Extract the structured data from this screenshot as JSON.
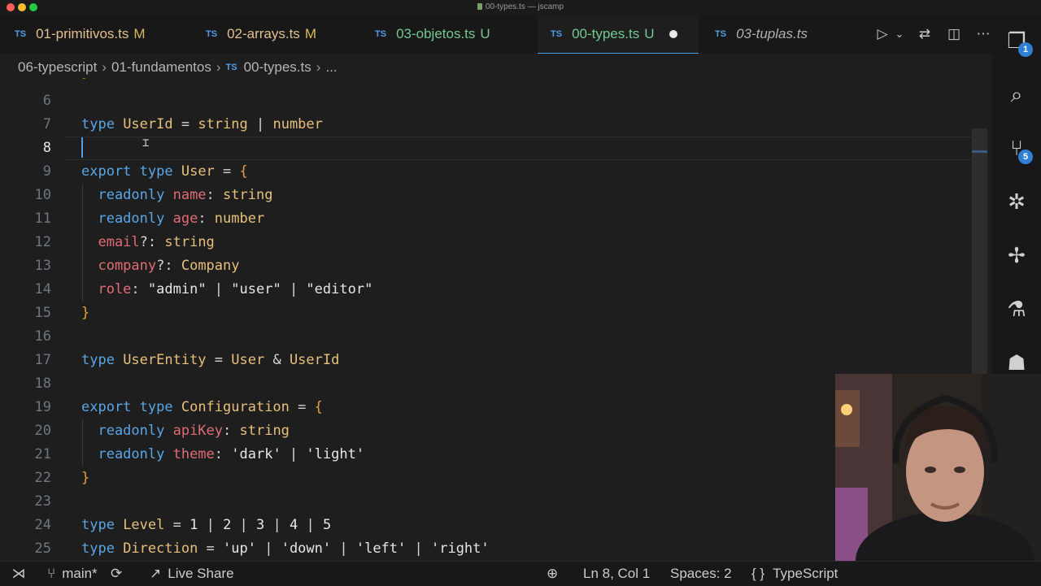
{
  "window": {
    "title": "00-types.ts — jscamp",
    "colors": {
      "close": "#ff5f57",
      "minimize": "#febc2e",
      "zoom": "#28c840"
    }
  },
  "tabs": [
    {
      "lang": "TS",
      "label": "01-primitivos.ts",
      "status": "M",
      "status_color": "#d9b65c",
      "label_color": "#e2c08d"
    },
    {
      "lang": "TS",
      "label": "02-arrays.ts",
      "status": "M",
      "status_color": "#d9b65c",
      "label_color": "#e2c08d"
    },
    {
      "lang": "TS",
      "label": "03-objetos.ts",
      "status": "U",
      "status_color": "#73c991",
      "label_color": "#73c991"
    },
    {
      "lang": "TS",
      "label": "00-types.ts",
      "status": "U",
      "status_color": "#73c991",
      "label_color": "#73c991",
      "active": true,
      "unsaved": true
    },
    {
      "lang": "TS",
      "label": "03-tuplas.ts",
      "status": "",
      "status_color": "#b0b0b0",
      "label_color": "#b0b0b0",
      "italic": true
    }
  ],
  "tab_actions": {
    "run": "▷",
    "run_dropdown": "⌄",
    "compare": "⇄",
    "split": "◫",
    "more": "⋯"
  },
  "breadcrumb": {
    "items": [
      "06-typescript",
      "01-fundamentos"
    ],
    "file_lang": "TS",
    "file": "00-types.ts",
    "trailing": "..."
  },
  "editor": {
    "first_line_partial": "}",
    "lines": [
      {
        "n": "6",
        "tokens": []
      },
      {
        "n": "7",
        "tokens": [
          {
            "t": "type ",
            "c": "kw"
          },
          {
            "t": "UserId",
            "c": "ty"
          },
          {
            "t": " = ",
            "c": "punc"
          },
          {
            "t": "string",
            "c": "ty"
          },
          {
            "t": " | ",
            "c": "punc"
          },
          {
            "t": "number",
            "c": "ty"
          }
        ]
      },
      {
        "n": "8",
        "current": true,
        "tokens": []
      },
      {
        "n": "9",
        "tokens": [
          {
            "t": "export ",
            "c": "kw"
          },
          {
            "t": "type ",
            "c": "kw"
          },
          {
            "t": "User",
            "c": "ty"
          },
          {
            "t": " = ",
            "c": "punc"
          },
          {
            "t": "{",
            "c": "brace"
          }
        ]
      },
      {
        "n": "10",
        "tokens": [
          {
            "t": "  readonly ",
            "c": "kw"
          },
          {
            "t": "name",
            "c": "prop"
          },
          {
            "t": ": ",
            "c": "punc"
          },
          {
            "t": "string",
            "c": "ty"
          }
        ]
      },
      {
        "n": "11",
        "tokens": [
          {
            "t": "  readonly ",
            "c": "kw"
          },
          {
            "t": "age",
            "c": "prop"
          },
          {
            "t": ": ",
            "c": "punc"
          },
          {
            "t": "number",
            "c": "ty"
          }
        ]
      },
      {
        "n": "12",
        "tokens": [
          {
            "t": "  email",
            "c": "prop"
          },
          {
            "t": "?: ",
            "c": "punc"
          },
          {
            "t": "string",
            "c": "ty"
          }
        ]
      },
      {
        "n": "13",
        "tokens": [
          {
            "t": "  company",
            "c": "prop"
          },
          {
            "t": "?: ",
            "c": "punc"
          },
          {
            "t": "Company",
            "c": "ty"
          }
        ]
      },
      {
        "n": "14",
        "tokens": [
          {
            "t": "  role",
            "c": "prop"
          },
          {
            "t": ": ",
            "c": "punc"
          },
          {
            "t": "\"admin\"",
            "c": "str"
          },
          {
            "t": " | ",
            "c": "punc"
          },
          {
            "t": "\"user\"",
            "c": "str"
          },
          {
            "t": " | ",
            "c": "punc"
          },
          {
            "t": "\"editor\"",
            "c": "str"
          }
        ]
      },
      {
        "n": "15",
        "tokens": [
          {
            "t": "}",
            "c": "brace"
          }
        ]
      },
      {
        "n": "16",
        "tokens": []
      },
      {
        "n": "17",
        "tokens": [
          {
            "t": "type ",
            "c": "kw"
          },
          {
            "t": "UserEntity",
            "c": "ty"
          },
          {
            "t": " = ",
            "c": "punc"
          },
          {
            "t": "User",
            "c": "ty"
          },
          {
            "t": " & ",
            "c": "punc"
          },
          {
            "t": "UserId",
            "c": "ty"
          }
        ]
      },
      {
        "n": "18",
        "tokens": []
      },
      {
        "n": "19",
        "tokens": [
          {
            "t": "export ",
            "c": "kw"
          },
          {
            "t": "type ",
            "c": "kw"
          },
          {
            "t": "Configuration",
            "c": "ty"
          },
          {
            "t": " = ",
            "c": "punc"
          },
          {
            "t": "{",
            "c": "brace"
          }
        ]
      },
      {
        "n": "20",
        "tokens": [
          {
            "t": "  readonly ",
            "c": "kw"
          },
          {
            "t": "apiKey",
            "c": "prop"
          },
          {
            "t": ": ",
            "c": "punc"
          },
          {
            "t": "string",
            "c": "ty"
          }
        ]
      },
      {
        "n": "21",
        "tokens": [
          {
            "t": "  readonly ",
            "c": "kw"
          },
          {
            "t": "theme",
            "c": "prop"
          },
          {
            "t": ": ",
            "c": "punc"
          },
          {
            "t": "'dark'",
            "c": "str"
          },
          {
            "t": " | ",
            "c": "punc"
          },
          {
            "t": "'light'",
            "c": "str"
          }
        ]
      },
      {
        "n": "22",
        "tokens": [
          {
            "t": "}",
            "c": "brace"
          }
        ]
      },
      {
        "n": "23",
        "tokens": []
      },
      {
        "n": "24",
        "tokens": [
          {
            "t": "type ",
            "c": "kw"
          },
          {
            "t": "Level",
            "c": "ty"
          },
          {
            "t": " = ",
            "c": "punc"
          },
          {
            "t": "1",
            "c": "num"
          },
          {
            "t": " | ",
            "c": "punc"
          },
          {
            "t": "2",
            "c": "num"
          },
          {
            "t": " | ",
            "c": "punc"
          },
          {
            "t": "3",
            "c": "num"
          },
          {
            "t": " | ",
            "c": "punc"
          },
          {
            "t": "4",
            "c": "num"
          },
          {
            "t": " | ",
            "c": "punc"
          },
          {
            "t": "5",
            "c": "num"
          }
        ]
      },
      {
        "n": "25",
        "tokens": [
          {
            "t": "type ",
            "c": "kw"
          },
          {
            "t": "Direction",
            "c": "ty"
          },
          {
            "t": " = ",
            "c": "punc"
          },
          {
            "t": "'up'",
            "c": "str"
          },
          {
            "t": " | ",
            "c": "punc"
          },
          {
            "t": "'down'",
            "c": "str"
          },
          {
            "t": " | ",
            "c": "punc"
          },
          {
            "t": "'left'",
            "c": "str"
          },
          {
            "t": " | ",
            "c": "punc"
          },
          {
            "t": "'right'",
            "c": "str"
          }
        ]
      }
    ]
  },
  "activity_bar": [
    {
      "name": "explorer-icon",
      "glyph": "❐",
      "badge": "1"
    },
    {
      "name": "search-icon",
      "glyph": "⌕",
      "badge": ""
    },
    {
      "name": "source-control-icon",
      "glyph": "⑂",
      "badge": "5"
    },
    {
      "name": "debug-icon",
      "glyph": "✲",
      "badge": ""
    },
    {
      "name": "extensions-icon",
      "glyph": "✢",
      "badge": ""
    },
    {
      "name": "testing-icon",
      "glyph": "⚗",
      "badge": ""
    },
    {
      "name": "github-icon",
      "glyph": "☗",
      "badge": ""
    }
  ],
  "status_bar": {
    "remote_glyph": "⋊",
    "branch": "main*",
    "sync_glyph": "⟳",
    "live_share": "Live Share",
    "zoom_glyph": "⊕",
    "position": "Ln 8, Col 1",
    "spaces": "Spaces: 2",
    "language_glyph": "{ }",
    "language": "TypeScript"
  }
}
